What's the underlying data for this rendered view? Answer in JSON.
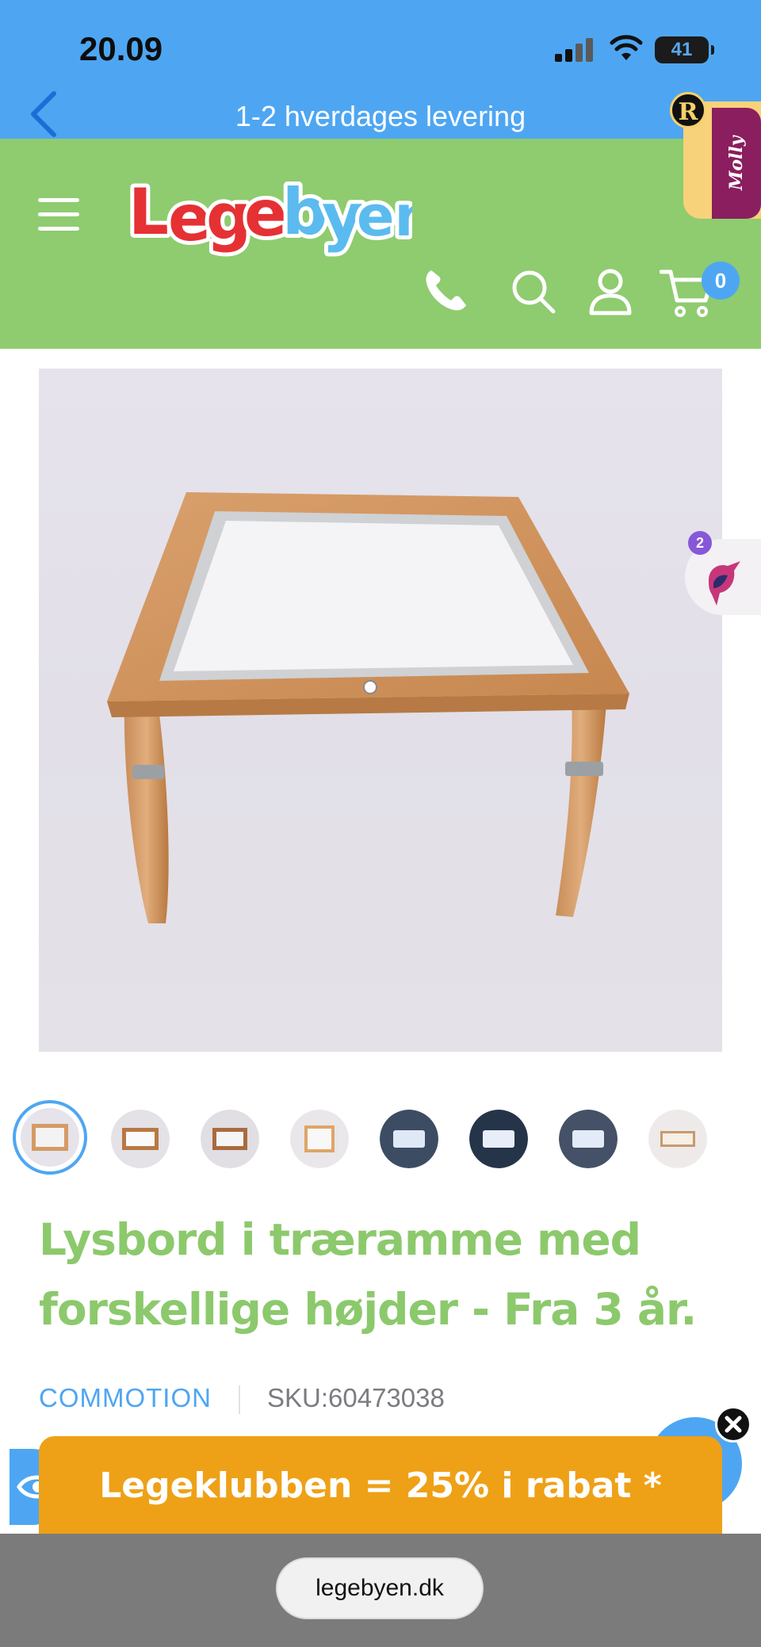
{
  "status_bar": {
    "time": "20.09",
    "battery": "41"
  },
  "shipping_banner": {
    "text": "1-2 hverdages levering"
  },
  "header": {
    "brand": "Legebyen",
    "cart_count": "0",
    "icons": [
      "menu-icon",
      "phone-icon",
      "search-icon",
      "account-icon",
      "cart-icon"
    ]
  },
  "floating": {
    "molly_label": "Molly",
    "r_label": "R",
    "bird_count": "2"
  },
  "product": {
    "title": "Lysbord i træramme med forskellige højder - Fra 3 år.",
    "vendor": "COMMOTION",
    "sku": "SKU:60473038",
    "thumbnail_count": 8
  },
  "promo": {
    "club_banner": "Legeklubben = 25% i rabat *"
  },
  "browser": {
    "url": "legebyen.dk"
  },
  "colors": {
    "blue": "#4ea6f2",
    "green": "#8fcb6f",
    "orange": "#eea117",
    "title_green": "#8cc96c"
  }
}
